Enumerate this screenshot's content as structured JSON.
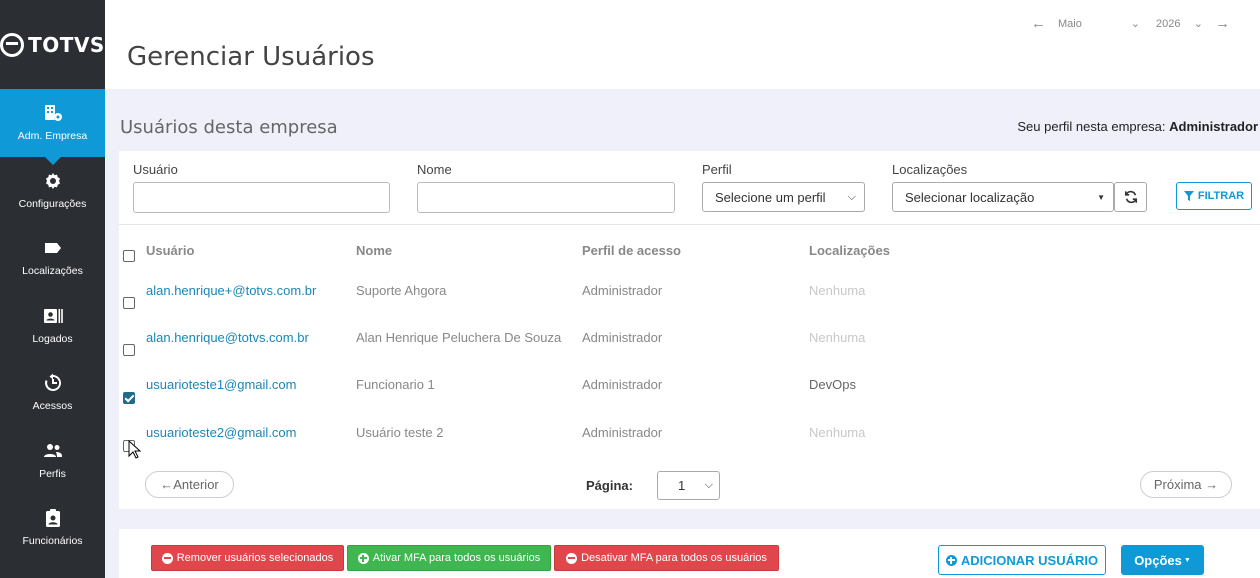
{
  "sidebar": {
    "logo_text": "TOTVS",
    "items": [
      {
        "label": "Adm. Empresa",
        "icon": "building-gear-icon",
        "active": true
      },
      {
        "label": "Configurações",
        "icon": "gear-icon",
        "active": false
      },
      {
        "label": "Localizações",
        "icon": "tag-icon",
        "active": false
      },
      {
        "label": "Logados",
        "icon": "id-card-icon",
        "active": false
      },
      {
        "label": "Acessos",
        "icon": "history-icon",
        "active": false
      },
      {
        "label": "Perfis",
        "icon": "users-icon",
        "active": false
      },
      {
        "label": "Funcionários",
        "icon": "clipboard-user-icon",
        "active": false
      }
    ]
  },
  "header": {
    "title": "Gerenciar Usuários",
    "month": "Maio",
    "year": "2026"
  },
  "content": {
    "section_title": "Usuários desta empresa",
    "profile_prefix": "Seu perfil nesta empresa:",
    "profile_value": "Administrador"
  },
  "filters": {
    "usuario_label": "Usuário",
    "nome_label": "Nome",
    "perfil_label": "Perfil",
    "perfil_value": "Selecione um perfil",
    "localizacoes_label": "Localizações",
    "localizacoes_value": "Selecionar localização",
    "filter_button": "FILTRAR"
  },
  "table": {
    "columns": [
      "Usuário",
      "Nome",
      "Perfil de acesso",
      "Localizações"
    ],
    "rows": [
      {
        "email": "alan.henrique+@totvs.com.br",
        "nome": "Suporte Ahgora",
        "perfil": "Administrador",
        "localizacoes": "Nenhuma",
        "checked": false
      },
      {
        "email": "alan.henrique@totvs.com.br",
        "nome": "Alan Henrique Peluchera De Souza",
        "perfil": "Administrador",
        "localizacoes": "Nenhuma",
        "checked": false
      },
      {
        "email": "usuarioteste1@gmail.com",
        "nome": "Funcionario 1",
        "perfil": "Administrador",
        "localizacoes": "DevOps",
        "checked": true
      },
      {
        "email": "usuarioteste2@gmail.com",
        "nome": "Usuário teste 2",
        "perfil": "Administrador",
        "localizacoes": "Nenhuma",
        "checked": false
      }
    ]
  },
  "pagination": {
    "prev": "←Anterior",
    "next": "Próxima →",
    "page_label": "Página:",
    "page_value": "1"
  },
  "actions": {
    "remove": "Remover usuários selecionados",
    "enable_mfa": "Ativar MFA para todos os usuários",
    "disable_mfa": "Desativar MFA para todos os usuários",
    "add_user": "ADICIONAR USUÁRIO",
    "options": "Opções"
  },
  "colors": {
    "accent": "#0f9ad7",
    "sidebar_bg": "#2b2e33",
    "danger": "#e0474c",
    "success": "#3fb650"
  }
}
